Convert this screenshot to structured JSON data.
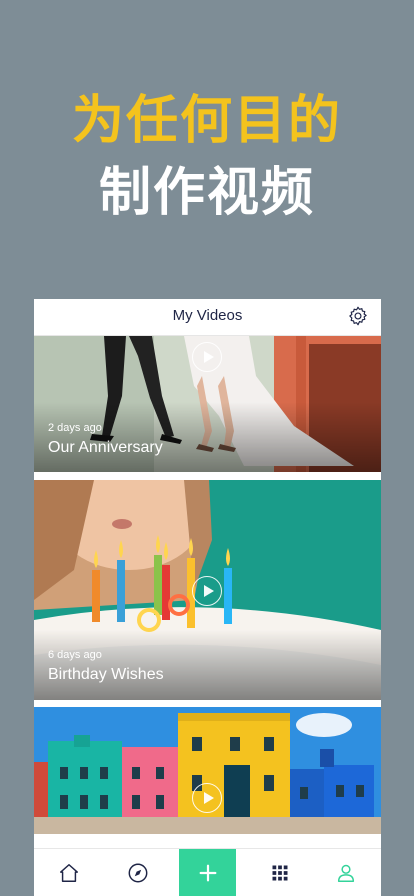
{
  "promo": {
    "line1": "为任何目的",
    "line2": "制作视频"
  },
  "header": {
    "title": "My Videos",
    "settings_icon": "gear-icon"
  },
  "videos": [
    {
      "time": "2 days ago",
      "title": "Our Anniversary"
    },
    {
      "time": "6 days ago",
      "title": "Birthday Wishes"
    },
    {
      "time": "",
      "title": ""
    }
  ],
  "tabbar": {
    "items": [
      {
        "icon": "home-icon"
      },
      {
        "icon": "compass-icon"
      },
      {
        "icon": "plus-icon"
      },
      {
        "icon": "grid-icon"
      },
      {
        "icon": "profile-icon"
      }
    ],
    "accent": "#33d39a"
  }
}
